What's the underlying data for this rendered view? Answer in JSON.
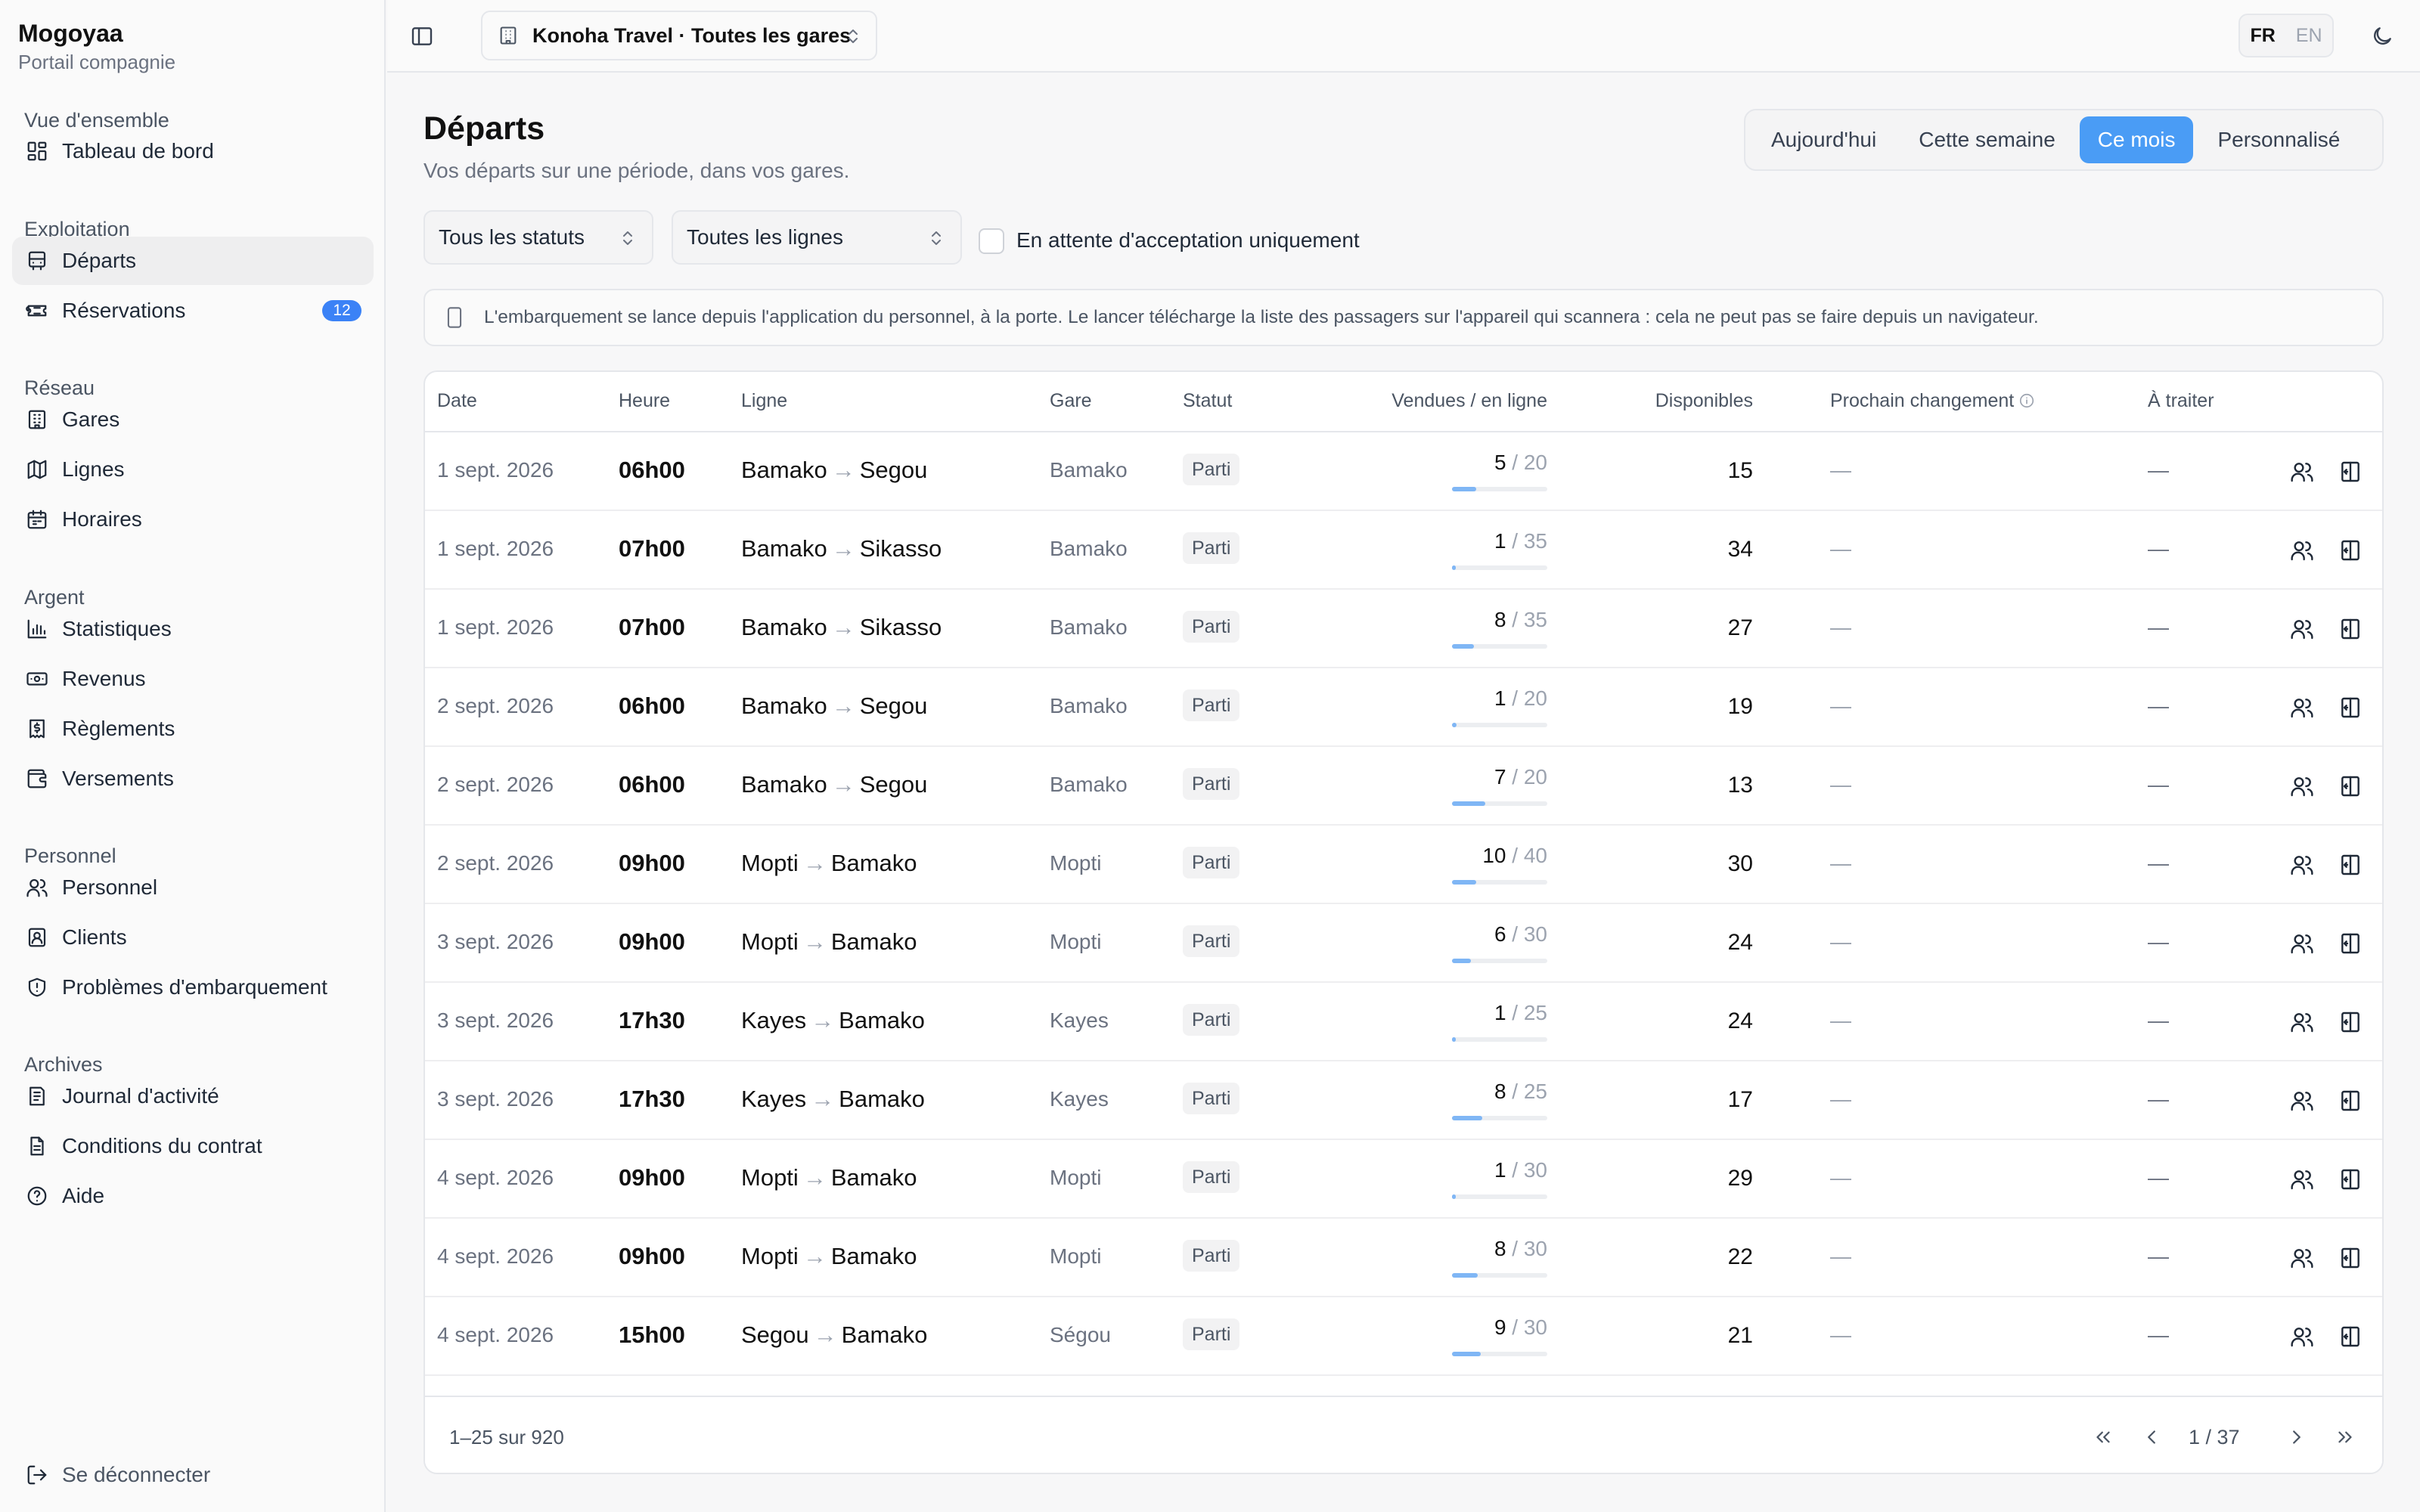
{
  "app": {
    "name": "Mogoyaa",
    "subtitle": "Portail compagnie"
  },
  "sidebar": {
    "sections": [
      {
        "title": "Vue d'ensemble",
        "items": [
          {
            "label": "Tableau de bord",
            "icon": "dashboard-icon"
          }
        ]
      },
      {
        "title": "Exploitation",
        "items": [
          {
            "label": "Départs",
            "icon": "bus-icon",
            "active": true
          },
          {
            "label": "Réservations",
            "icon": "ticket-icon",
            "badge": "12"
          }
        ]
      },
      {
        "title": "Réseau",
        "items": [
          {
            "label": "Gares",
            "icon": "building-icon"
          },
          {
            "label": "Lignes",
            "icon": "map-icon"
          },
          {
            "label": "Horaires",
            "icon": "calendar-icon"
          }
        ]
      },
      {
        "title": "Argent",
        "items": [
          {
            "label": "Statistiques",
            "icon": "chart-icon"
          },
          {
            "label": "Revenus",
            "icon": "banknote-icon"
          },
          {
            "label": "Règlements",
            "icon": "receipt-icon"
          },
          {
            "label": "Versements",
            "icon": "wallet-icon"
          }
        ]
      },
      {
        "title": "Personnel",
        "items": [
          {
            "label": "Personnel",
            "icon": "users-icon"
          },
          {
            "label": "Clients",
            "icon": "contact-icon"
          },
          {
            "label": "Problèmes d'embarquement",
            "icon": "shield-alert-icon"
          }
        ]
      },
      {
        "title": "Archives",
        "items": [
          {
            "label": "Journal d'activité",
            "icon": "log-icon"
          },
          {
            "label": "Conditions du contrat",
            "icon": "file-icon"
          },
          {
            "label": "Aide",
            "icon": "help-icon"
          }
        ]
      }
    ],
    "logout": "Se déconnecter"
  },
  "topbar": {
    "org_select": "Konoha Travel · Toutes les gares",
    "lang_active": "FR",
    "lang_other": "EN"
  },
  "page": {
    "title": "Départs",
    "subtitle": "Vos départs sur une période, dans vos gares.",
    "periods": [
      "Aujourd'hui",
      "Cette semaine",
      "Ce mois",
      "Personnalisé"
    ],
    "active_period": 2,
    "filters": {
      "status": "Tous les statuts",
      "lines": "Toutes les lignes",
      "pending_only": "En attente d'acceptation uniquement",
      "pending_only_checked": false
    },
    "info_text": "L'embarquement se lance depuis l'application du personnel, à la porte. Le lancer télécharge la liste des passagers sur l'appareil qui scannera : cela ne peut pas se faire depuis un navigateur."
  },
  "table": {
    "columns": {
      "date": "Date",
      "time": "Heure",
      "line": "Ligne",
      "station": "Gare",
      "status": "Statut",
      "sold": "Vendues / en ligne",
      "available": "Disponibles",
      "next_change": "Prochain changement",
      "todo": "À traiter"
    },
    "rows": [
      {
        "date": "1 sept. 2026",
        "time": "06h00",
        "from": "Bamako",
        "to": "Segou",
        "station": "Bamako",
        "status": "Parti",
        "sold": 5,
        "total": 20,
        "available": "15",
        "next": "—",
        "todo": "—"
      },
      {
        "date": "1 sept. 2026",
        "time": "07h00",
        "from": "Bamako",
        "to": "Sikasso",
        "station": "Bamako",
        "status": "Parti",
        "sold": 1,
        "total": 35,
        "available": "34",
        "next": "—",
        "todo": "—"
      },
      {
        "date": "1 sept. 2026",
        "time": "07h00",
        "from": "Bamako",
        "to": "Sikasso",
        "station": "Bamako",
        "status": "Parti",
        "sold": 8,
        "total": 35,
        "available": "27",
        "next": "—",
        "todo": "—"
      },
      {
        "date": "2 sept. 2026",
        "time": "06h00",
        "from": "Bamako",
        "to": "Segou",
        "station": "Bamako",
        "status": "Parti",
        "sold": 1,
        "total": 20,
        "available": "19",
        "next": "—",
        "todo": "—"
      },
      {
        "date": "2 sept. 2026",
        "time": "06h00",
        "from": "Bamako",
        "to": "Segou",
        "station": "Bamako",
        "status": "Parti",
        "sold": 7,
        "total": 20,
        "available": "13",
        "next": "—",
        "todo": "—"
      },
      {
        "date": "2 sept. 2026",
        "time": "09h00",
        "from": "Mopti",
        "to": "Bamako",
        "station": "Mopti",
        "status": "Parti",
        "sold": 10,
        "total": 40,
        "available": "30",
        "next": "—",
        "todo": "—"
      },
      {
        "date": "3 sept. 2026",
        "time": "09h00",
        "from": "Mopti",
        "to": "Bamako",
        "station": "Mopti",
        "status": "Parti",
        "sold": 6,
        "total": 30,
        "available": "24",
        "next": "—",
        "todo": "—"
      },
      {
        "date": "3 sept. 2026",
        "time": "17h30",
        "from": "Kayes",
        "to": "Bamako",
        "station": "Kayes",
        "status": "Parti",
        "sold": 1,
        "total": 25,
        "available": "24",
        "next": "—",
        "todo": "—"
      },
      {
        "date": "3 sept. 2026",
        "time": "17h30",
        "from": "Kayes",
        "to": "Bamako",
        "station": "Kayes",
        "status": "Parti",
        "sold": 8,
        "total": 25,
        "available": "17",
        "next": "—",
        "todo": "—"
      },
      {
        "date": "4 sept. 2026",
        "time": "09h00",
        "from": "Mopti",
        "to": "Bamako",
        "station": "Mopti",
        "status": "Parti",
        "sold": 1,
        "total": 30,
        "available": "29",
        "next": "—",
        "todo": "—"
      },
      {
        "date": "4 sept. 2026",
        "time": "09h00",
        "from": "Mopti",
        "to": "Bamako",
        "station": "Mopti",
        "status": "Parti",
        "sold": 8,
        "total": 30,
        "available": "22",
        "next": "—",
        "todo": "—"
      },
      {
        "date": "4 sept. 2026",
        "time": "15h00",
        "from": "Segou",
        "to": "Bamako",
        "station": "Ségou",
        "status": "Parti",
        "sold": 9,
        "total": 30,
        "available": "21",
        "next": "—",
        "todo": "—"
      }
    ],
    "range_label": "1–25 sur 920",
    "page_label": "1 / 37"
  }
}
